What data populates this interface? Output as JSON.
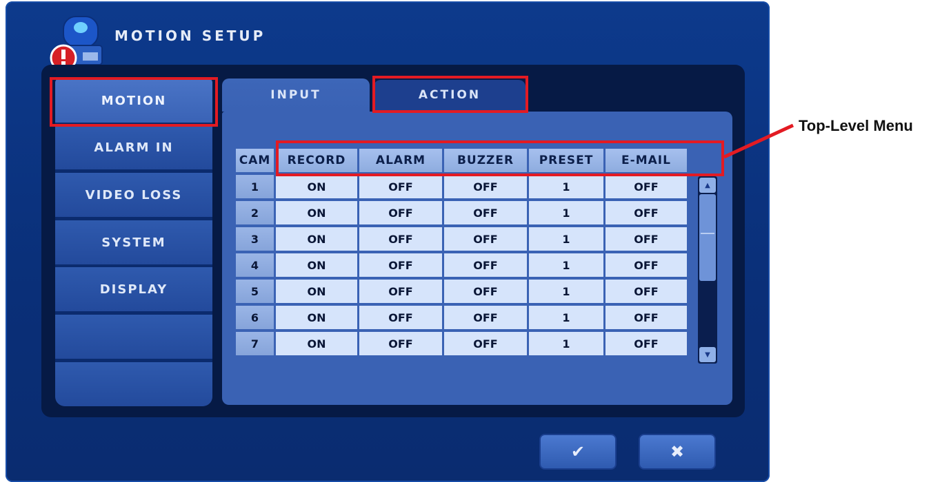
{
  "window": {
    "title": "MOTION SETUP"
  },
  "sidebar": {
    "items": [
      {
        "label": "MOTION"
      },
      {
        "label": "ALARM IN"
      },
      {
        "label": "VIDEO LOSS"
      },
      {
        "label": "SYSTEM"
      },
      {
        "label": "DISPLAY"
      }
    ]
  },
  "tabs": [
    {
      "label": "INPUT"
    },
    {
      "label": "ACTION"
    }
  ],
  "table": {
    "headers": [
      "CAM",
      "RECORD",
      "ALARM",
      "BUZZER",
      "PRESET",
      "E-MAIL"
    ],
    "rows": [
      [
        "1",
        "ON",
        "OFF",
        "OFF",
        "1",
        "OFF"
      ],
      [
        "2",
        "ON",
        "OFF",
        "OFF",
        "1",
        "OFF"
      ],
      [
        "3",
        "ON",
        "OFF",
        "OFF",
        "1",
        "OFF"
      ],
      [
        "4",
        "ON",
        "OFF",
        "OFF",
        "1",
        "OFF"
      ],
      [
        "5",
        "ON",
        "OFF",
        "OFF",
        "1",
        "OFF"
      ],
      [
        "6",
        "ON",
        "OFF",
        "OFF",
        "1",
        "OFF"
      ],
      [
        "7",
        "ON",
        "OFF",
        "OFF",
        "1",
        "OFF"
      ]
    ]
  },
  "buttons": {
    "ok_glyph": "✔",
    "cancel_glyph": "✖"
  },
  "annotation": {
    "label": "Top-Level Menu"
  },
  "colors": {
    "highlight": "#e31b23",
    "panel": "#0d3a8c",
    "cell": "#d6e4fb"
  }
}
